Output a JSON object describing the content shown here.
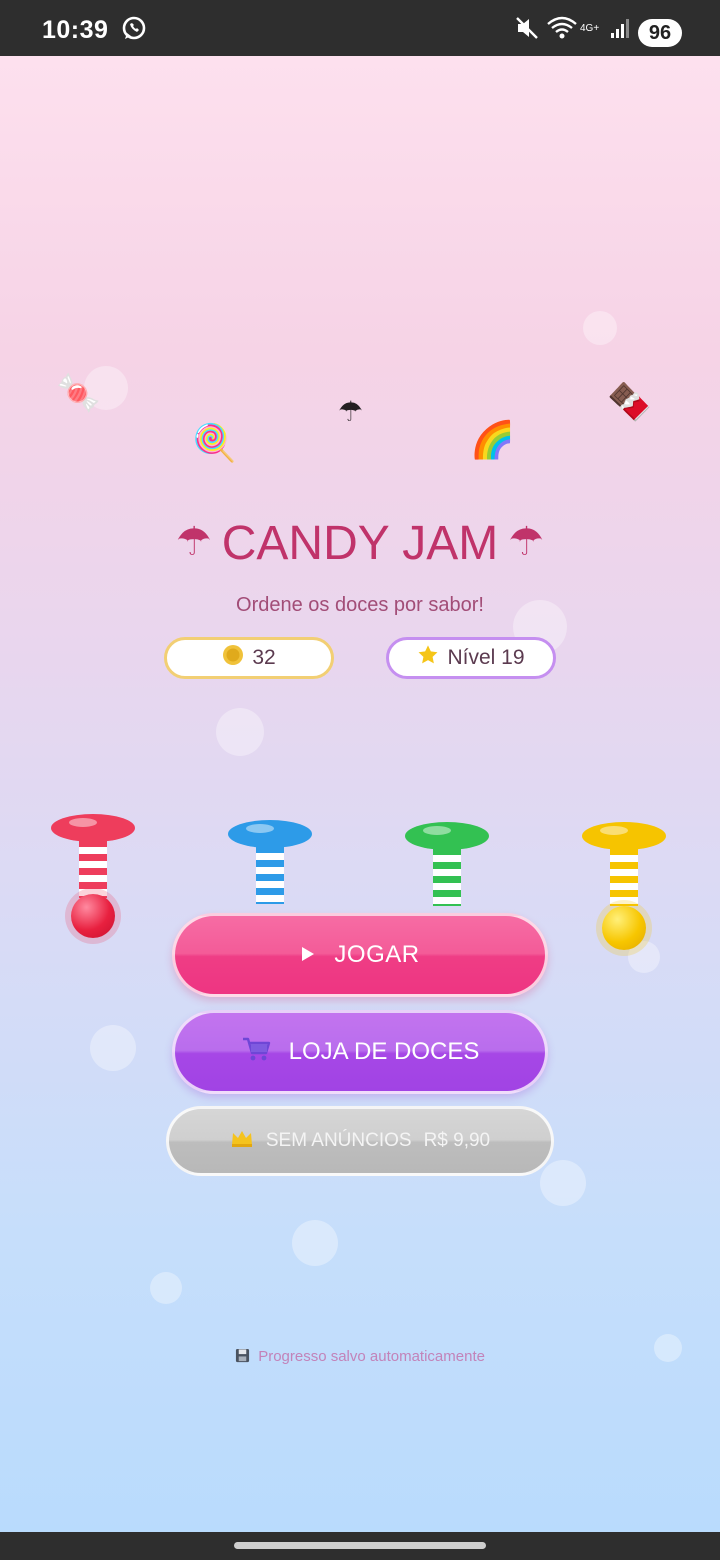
{
  "status_bar": {
    "time": "10:39",
    "battery": "96",
    "network": "4G+"
  },
  "app": {
    "title": "CANDY JAM",
    "title_icon": "umbrella-icon",
    "subtitle": "Ordene os doces por sabor!",
    "coins": {
      "icon": "coin-icon",
      "value": "32"
    },
    "level": {
      "icon": "star-icon",
      "label": "Nível 19"
    },
    "decorations": [
      "candy-icon",
      "lollipop-icon",
      "umbrella-icon",
      "rainbow-icon",
      "chocolate-icon"
    ],
    "tubes": [
      {
        "color": "#ee3d5c",
        "stripe": "#ffffff",
        "has_ball": true
      },
      {
        "color": "#2d9be8",
        "stripe": "#ffffff",
        "has_ball": false
      },
      {
        "color": "#33c152",
        "stripe": "#ffffff",
        "has_ball": false
      },
      {
        "color": "#f6c400",
        "stripe": "#ffffff",
        "has_ball": true
      }
    ],
    "buttons": {
      "play": {
        "icon": "play-icon",
        "label": "JOGAR"
      },
      "shop": {
        "icon": "cart-icon",
        "label": "LOJA DE DOCES"
      },
      "no_ads": {
        "icon": "crown-icon",
        "label": "SEM ANÚNCIOS",
        "price": "R$ 9,90"
      }
    },
    "footer": {
      "icon": "floppy-disk-icon",
      "text": "Progresso salvo automaticamente"
    }
  },
  "colors": {
    "title": "#c0336a",
    "play_button": "#f24a8e",
    "shop_button": "#b05ae9",
    "no_ads_button": "#c6c6c6",
    "coin_border": "#f2cf74",
    "level_border": "#c58ff0"
  }
}
